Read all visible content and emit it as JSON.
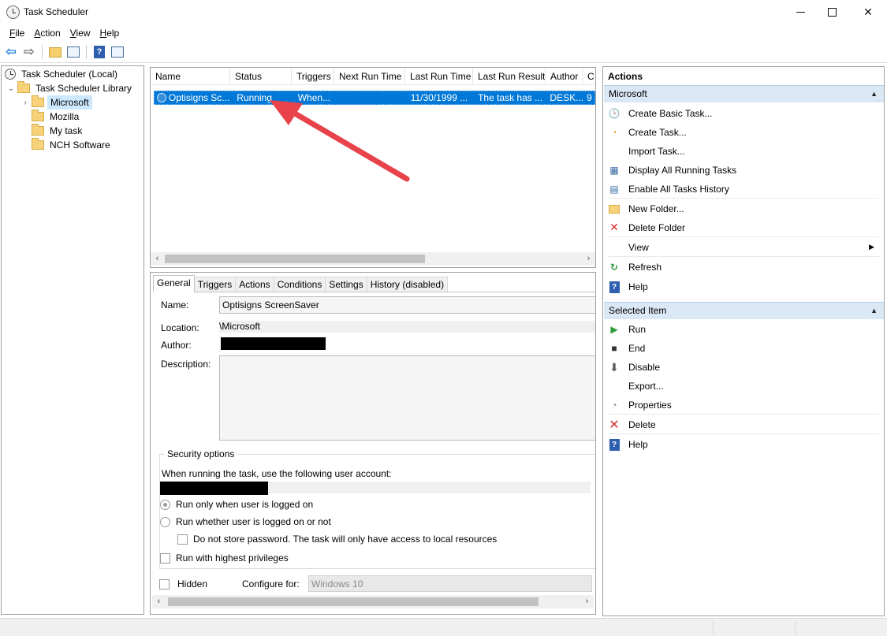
{
  "window": {
    "title": "Task Scheduler"
  },
  "menu": [
    {
      "label": "File",
      "ul": "F",
      "rest": "ile"
    },
    {
      "label": "Action",
      "ul": "A",
      "rest": "ction"
    },
    {
      "label": "View",
      "ul": "V",
      "rest": "iew"
    },
    {
      "label": "Help",
      "ul": "H",
      "rest": "elp"
    }
  ],
  "tree": {
    "root": "Task Scheduler (Local)",
    "library": "Task Scheduler Library",
    "folders": [
      "Microsoft",
      "Mozilla",
      "My task",
      "NCH Software"
    ],
    "selected": "Microsoft"
  },
  "task_list": {
    "columns": [
      "Name",
      "Status",
      "Triggers",
      "Next Run Time",
      "Last Run Time",
      "Last Run Result",
      "Author",
      "C"
    ],
    "rows": [
      {
        "name": "Optisigns Sc...",
        "status": "Running",
        "triggers": "When...",
        "next_run": "",
        "last_run": "11/30/1999 ...",
        "last_result": "The task has ...",
        "author": "DESK...",
        "c": "9"
      }
    ]
  },
  "detail": {
    "tabs": [
      "General",
      "Triggers",
      "Actions",
      "Conditions",
      "Settings",
      "History (disabled)"
    ],
    "active_tab": "General",
    "name_label": "Name:",
    "name_value": "Optisigns ScreenSaver",
    "location_label": "Location:",
    "location_value": "\\Microsoft",
    "author_label": "Author:",
    "description_label": "Description:",
    "security_title": "Security options",
    "user_account_text": "When running the task, use the following user account:",
    "radio_logged_on": "Run only when user is logged on",
    "radio_whether": "Run whether user is logged on or not",
    "no_store_pw": "Do not store password.  The task will only have access to local resources",
    "highest_priv": "Run with highest privileges",
    "hidden_label": "Hidden",
    "configure_label": "Configure for:",
    "configure_value": "Windows 10"
  },
  "actions": {
    "title": "Actions",
    "section1": "Microsoft",
    "items1": [
      {
        "label": "Create Basic Task...",
        "icon": "create-basic-task-icon"
      },
      {
        "label": "Create Task...",
        "icon": "create-task-icon"
      },
      {
        "label": "Import Task...",
        "icon": ""
      },
      {
        "label": "Display All Running Tasks",
        "icon": "running-tasks-icon"
      },
      {
        "label": "Enable All Tasks History",
        "icon": "history-icon"
      },
      {
        "label": "New Folder...",
        "icon": "new-folder-icon"
      },
      {
        "label": "Delete Folder",
        "icon": "delete-folder-icon"
      },
      {
        "label": "View",
        "icon": ""
      },
      {
        "label": "Refresh",
        "icon": "refresh-icon"
      },
      {
        "label": "Help",
        "icon": "help-icon"
      }
    ],
    "section2": "Selected Item",
    "items2": [
      {
        "label": "Run",
        "icon": "run-icon"
      },
      {
        "label": "End",
        "icon": "end-icon"
      },
      {
        "label": "Disable",
        "icon": "disable-icon"
      },
      {
        "label": "Export...",
        "icon": ""
      },
      {
        "label": "Properties",
        "icon": "properties-icon"
      },
      {
        "label": "Delete",
        "icon": "delete-icon"
      },
      {
        "label": "Help",
        "icon": "help-icon"
      }
    ]
  },
  "colors": {
    "selection": "#0078d7",
    "annotation_arrow": "#e8434b",
    "section_header": "#dae7f5"
  }
}
